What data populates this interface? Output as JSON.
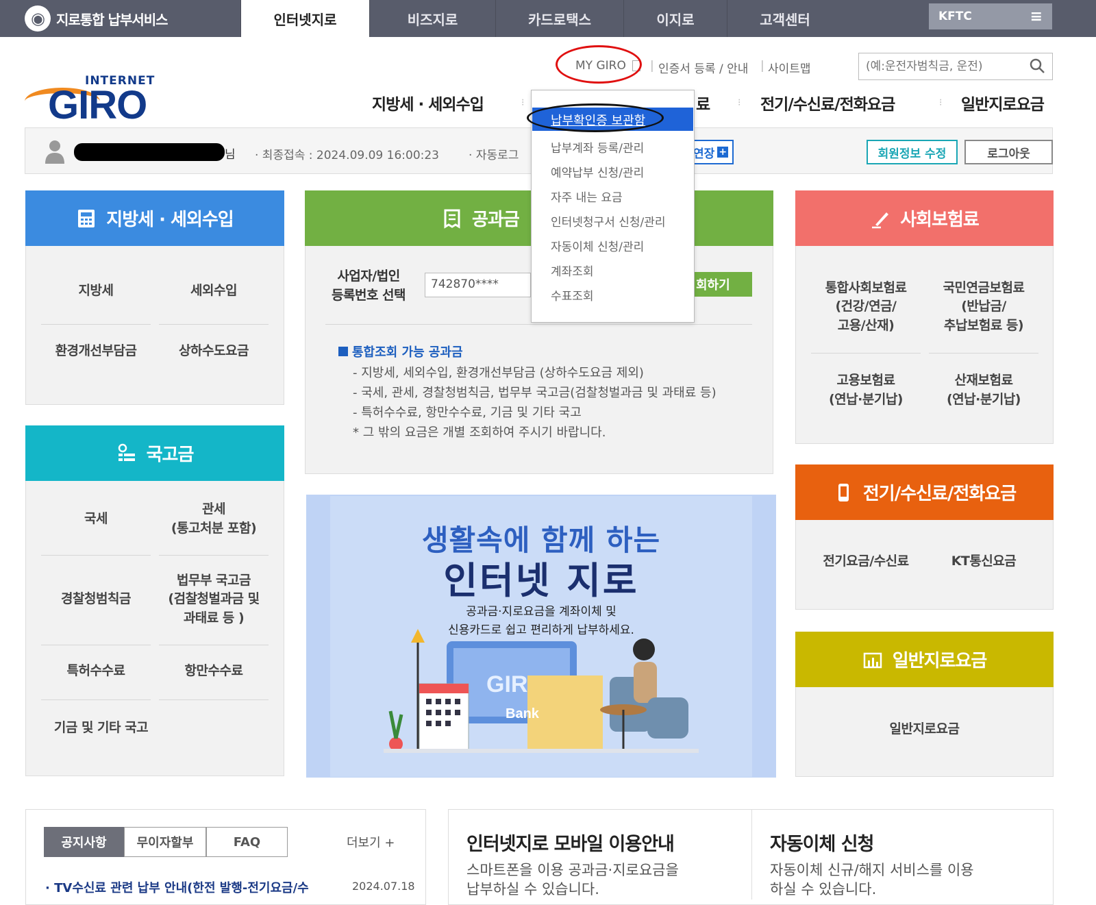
{
  "topbar": {
    "brand": "지로통합 납부서비스",
    "tabs": [
      "인터넷지로",
      "비즈지로",
      "카드로택스",
      "이지로",
      "고객센터"
    ],
    "kftc": "KFTC"
  },
  "util": {
    "mygiro": "MY GIRO",
    "cert": "인증서 등록 / 안내",
    "sitemap": "사이트맵",
    "search_placeholder": "(예:운전자범칙금, 운전)"
  },
  "logo": {
    "sub": "INTERNET",
    "main": "GIRO"
  },
  "gnav": [
    "지방세 · 세외수입",
    "료",
    "전기/수신료/전화요금",
    "일반지로요금"
  ],
  "user": {
    "suffix": "님",
    "last_login": "· 최종접속 : 2024.09.09 16:00:23",
    "auto_logout": "· 자동로그",
    "extend": "연장",
    "edit_profile": "회원정보 수정",
    "logout": "로그아웃"
  },
  "mygiro_menu": [
    "납부확인증 보관함",
    "납부계좌 등록/관리",
    "예약납부 신청/관리",
    "자주 내는 요금",
    "인터넷청구서 신청/관리",
    "자동이체 신청/관리",
    "계좌조회",
    "수표조회"
  ],
  "local_tax": {
    "title": "지방세 · 세외수입",
    "items": [
      "지방세",
      "세외수입",
      "환경개선부담금",
      "상하수도요금"
    ]
  },
  "public_fee": {
    "title": "공과금",
    "biz_label_1": "사업자/법인",
    "biz_label_2": "등록번호 선택",
    "biz_value": "742870****",
    "query_btn": "회하기",
    "notice_title": "통합조회 가능 공과금",
    "notice_lines": [
      "- 지방세, 세외수입, 환경개선부담금 (상하수도요금 제외)",
      "- 국세, 관세, 경찰청범칙금, 법무부 국고금(검찰청벌과금 및 과태료 등)",
      "- 특허수수료, 항만수수료, 기금 및 기타 국고",
      "* 그 밖의 요금은 개별 조회하여 주시기 바랍니다."
    ]
  },
  "social": {
    "title": "사회보험료",
    "items": [
      "통합사회보험료\n(건강/연금/\n고용/산재)",
      "국민연금보험료\n(반납금/\n추납보험료 등)",
      "고용보험료\n(연납·분기납)",
      "산재보험료\n(연납·분기납)"
    ]
  },
  "national": {
    "title": "국고금",
    "items": [
      "국세",
      "관세\n(통고처분 포함)",
      "경찰청범칙금",
      "법무부 국고금\n(검찰청벌과금 및\n과태료 등 )",
      "특허수수료",
      "항만수수료",
      "기금 및 기타 국고"
    ]
  },
  "banner": {
    "line1": "생활속에 함께 하는",
    "line2": "인터넷 지로",
    "desc1": "공과금·지로요금을 계좌이체 및",
    "desc2": "신용카드로 쉽고 편리하게 납부하세요.",
    "art_giro": "GIRO",
    "art_bank": "Bank"
  },
  "utility": {
    "title": "전기/수신료/전화요금",
    "items": [
      "전기요금/수신료",
      "KT통신요금"
    ]
  },
  "general": {
    "title": "일반지로요금",
    "items": [
      "일반지로요금"
    ]
  },
  "notice": {
    "tabs": [
      "공지사항",
      "무이자할부",
      "FAQ"
    ],
    "more": "더보기 +",
    "item": "· TV수신료 관련 납부 안내(한전 발행-전기요금/수",
    "date": "2024.07.18"
  },
  "mobile": {
    "title": "인터넷지로 모바일 이용안내",
    "text1": "스마트폰을 이용 공과금·지로요금을",
    "text2": "납부하실 수 있습니다."
  },
  "autopay": {
    "title": "자동이체 신청",
    "text1": "자동이체 신규/해지 서비스를 이용",
    "text2": "하실 수 있습니다."
  },
  "colors": {
    "topbar": "#585c6b",
    "local_tax": "#3b8be0",
    "public_fee": "#72b043",
    "social": "#f2706b",
    "national": "#14b6c8",
    "utility": "#e8610f",
    "general": "#c9b800",
    "highlight_blue": "#1f63d8",
    "annotation_red": "#e01010"
  }
}
